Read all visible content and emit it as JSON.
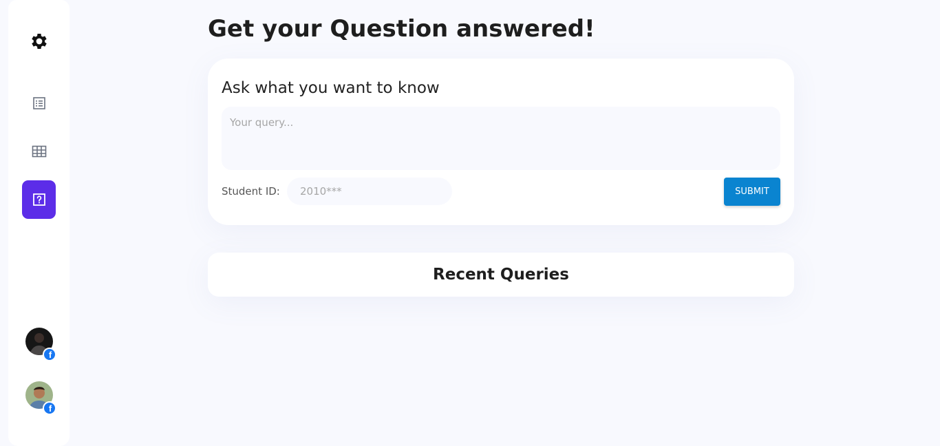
{
  "sidebar": {
    "items": [
      {
        "icon": "gear-icon",
        "active": false
      },
      {
        "icon": "list-icon",
        "active": false
      },
      {
        "icon": "grid-table-icon",
        "active": false
      },
      {
        "icon": "question-icon",
        "active": true
      }
    ],
    "avatars": [
      {
        "icon": "facebook-icon",
        "badge": "f"
      },
      {
        "icon": "facebook-icon",
        "badge": "f"
      }
    ]
  },
  "page": {
    "title": "Get your Question answered!"
  },
  "ask_card": {
    "heading": "Ask what you want to know",
    "query_placeholder": "Your query...",
    "student_id_label": "Student ID:",
    "student_id_placeholder": "2010***",
    "submit_label": "SUBMIT"
  },
  "recent": {
    "title": "Recent Queries"
  },
  "colors": {
    "background": "#f8f9fe",
    "accent": "#5c2de8",
    "submit": "#0a84d0",
    "facebook": "#1877f2"
  }
}
